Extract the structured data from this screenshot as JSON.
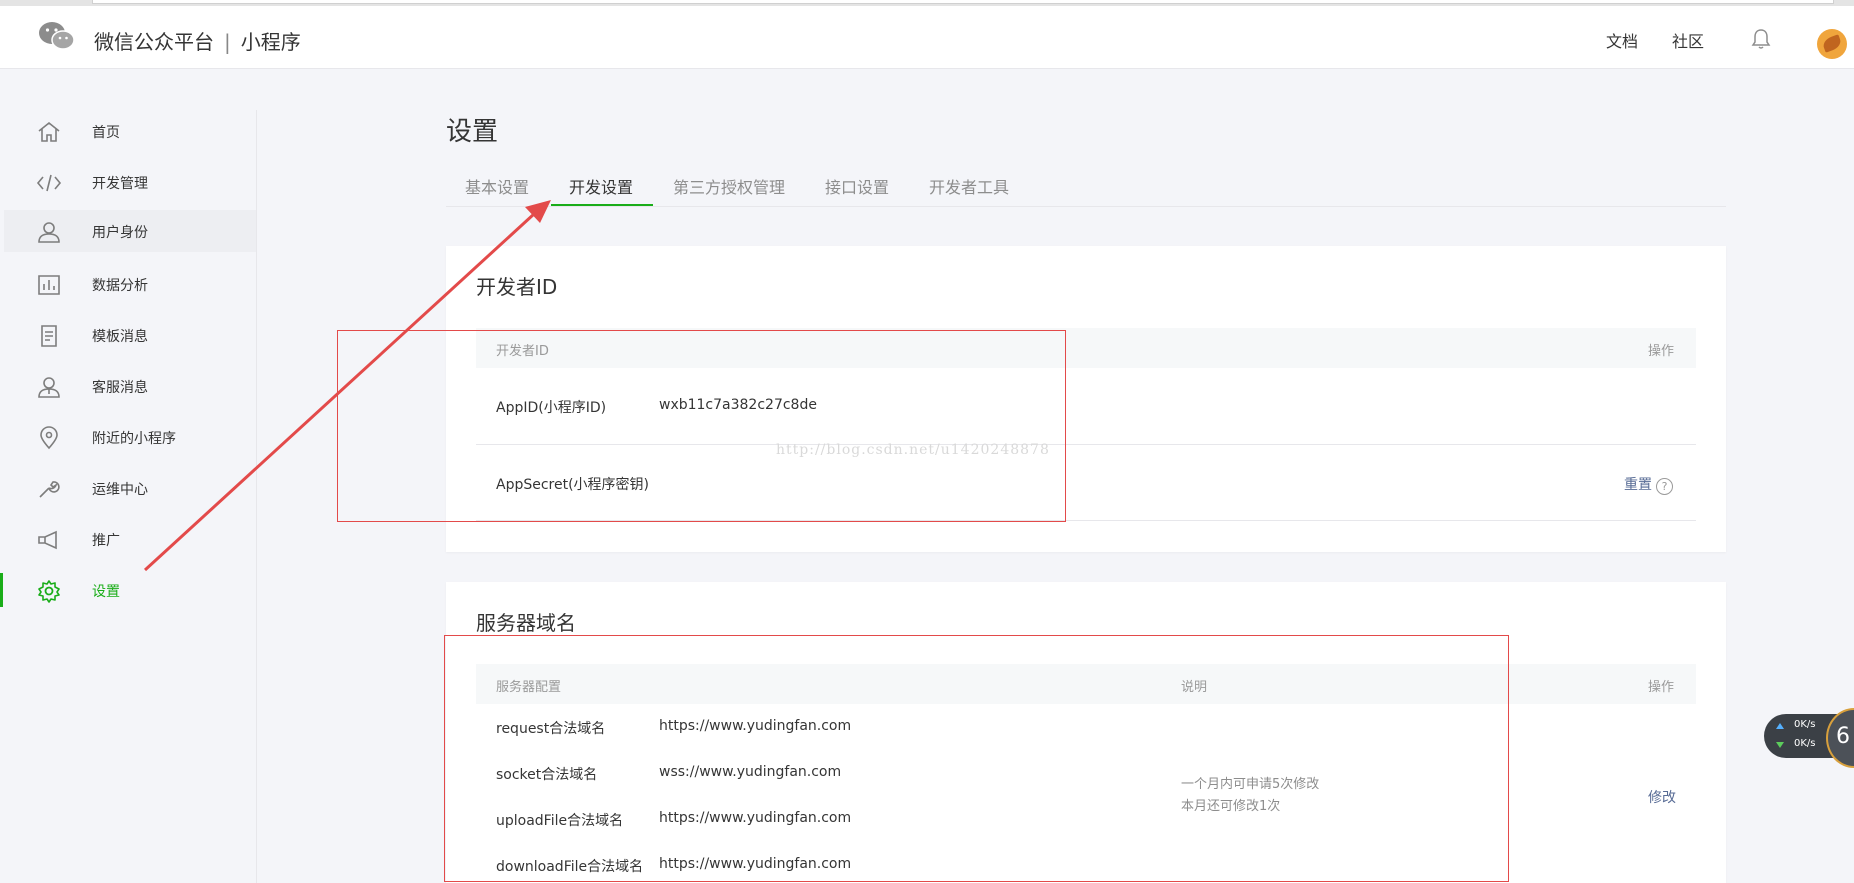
{
  "header": {
    "platform": "微信公众平台",
    "separator": "|",
    "product": "小程序",
    "links": [
      "文档",
      "社区"
    ]
  },
  "sidebar": {
    "items": [
      {
        "label": "首页",
        "icon": "home-icon"
      },
      {
        "label": "开发管理",
        "icon": "code-icon"
      },
      {
        "label": "用户身份",
        "icon": "user-icon"
      },
      {
        "label": "数据分析",
        "icon": "chart-icon"
      },
      {
        "label": "模板消息",
        "icon": "document-icon"
      },
      {
        "label": "客服消息",
        "icon": "customer-service-icon"
      },
      {
        "label": "附近的小程序",
        "icon": "location-icon"
      },
      {
        "label": "运维中心",
        "icon": "wrench-icon"
      },
      {
        "label": "推广",
        "icon": "megaphone-icon"
      },
      {
        "label": "设置",
        "icon": "gear-icon"
      }
    ],
    "active": "设置"
  },
  "page": {
    "title": "设置",
    "tabs": [
      "基本设置",
      "开发设置",
      "第三方授权管理",
      "接口设置",
      "开发者工具"
    ],
    "active_tab": "开发设置"
  },
  "developer_id": {
    "title": "开发者ID",
    "header_left": "开发者ID",
    "header_right": "操作",
    "appid_label": "AppID(小程序ID)",
    "appid_value": "wxb11c7a382c27c8de",
    "secret_label": "AppSecret(小程序密钥)",
    "secret_action": "重置",
    "help_mark": "?"
  },
  "server_domain": {
    "title": "服务器域名",
    "headers": [
      "服务器配置",
      "说明",
      "操作"
    ],
    "rows": [
      {
        "label": "request合法域名",
        "value": "https://www.yudingfan.com"
      },
      {
        "label": "socket合法域名",
        "value": "wss://www.yudingfan.com"
      },
      {
        "label": "uploadFile合法域名",
        "value": "https://www.yudingfan.com"
      },
      {
        "label": "downloadFile合法域名",
        "value": "https://www.yudingfan.com"
      }
    ],
    "note_line1": "一个月内可申请5次修改",
    "note_line2": "本月还可修改1次",
    "action": "修改"
  },
  "watermark": "http://blog.csdn.net/u1420248878",
  "speed_widget": {
    "up": "0K/s",
    "down": "0K/s",
    "badge": "6"
  },
  "colors": {
    "accent_green": "#1aad19",
    "link_blue": "#576b95",
    "annotation_red": "#e34a4a"
  }
}
